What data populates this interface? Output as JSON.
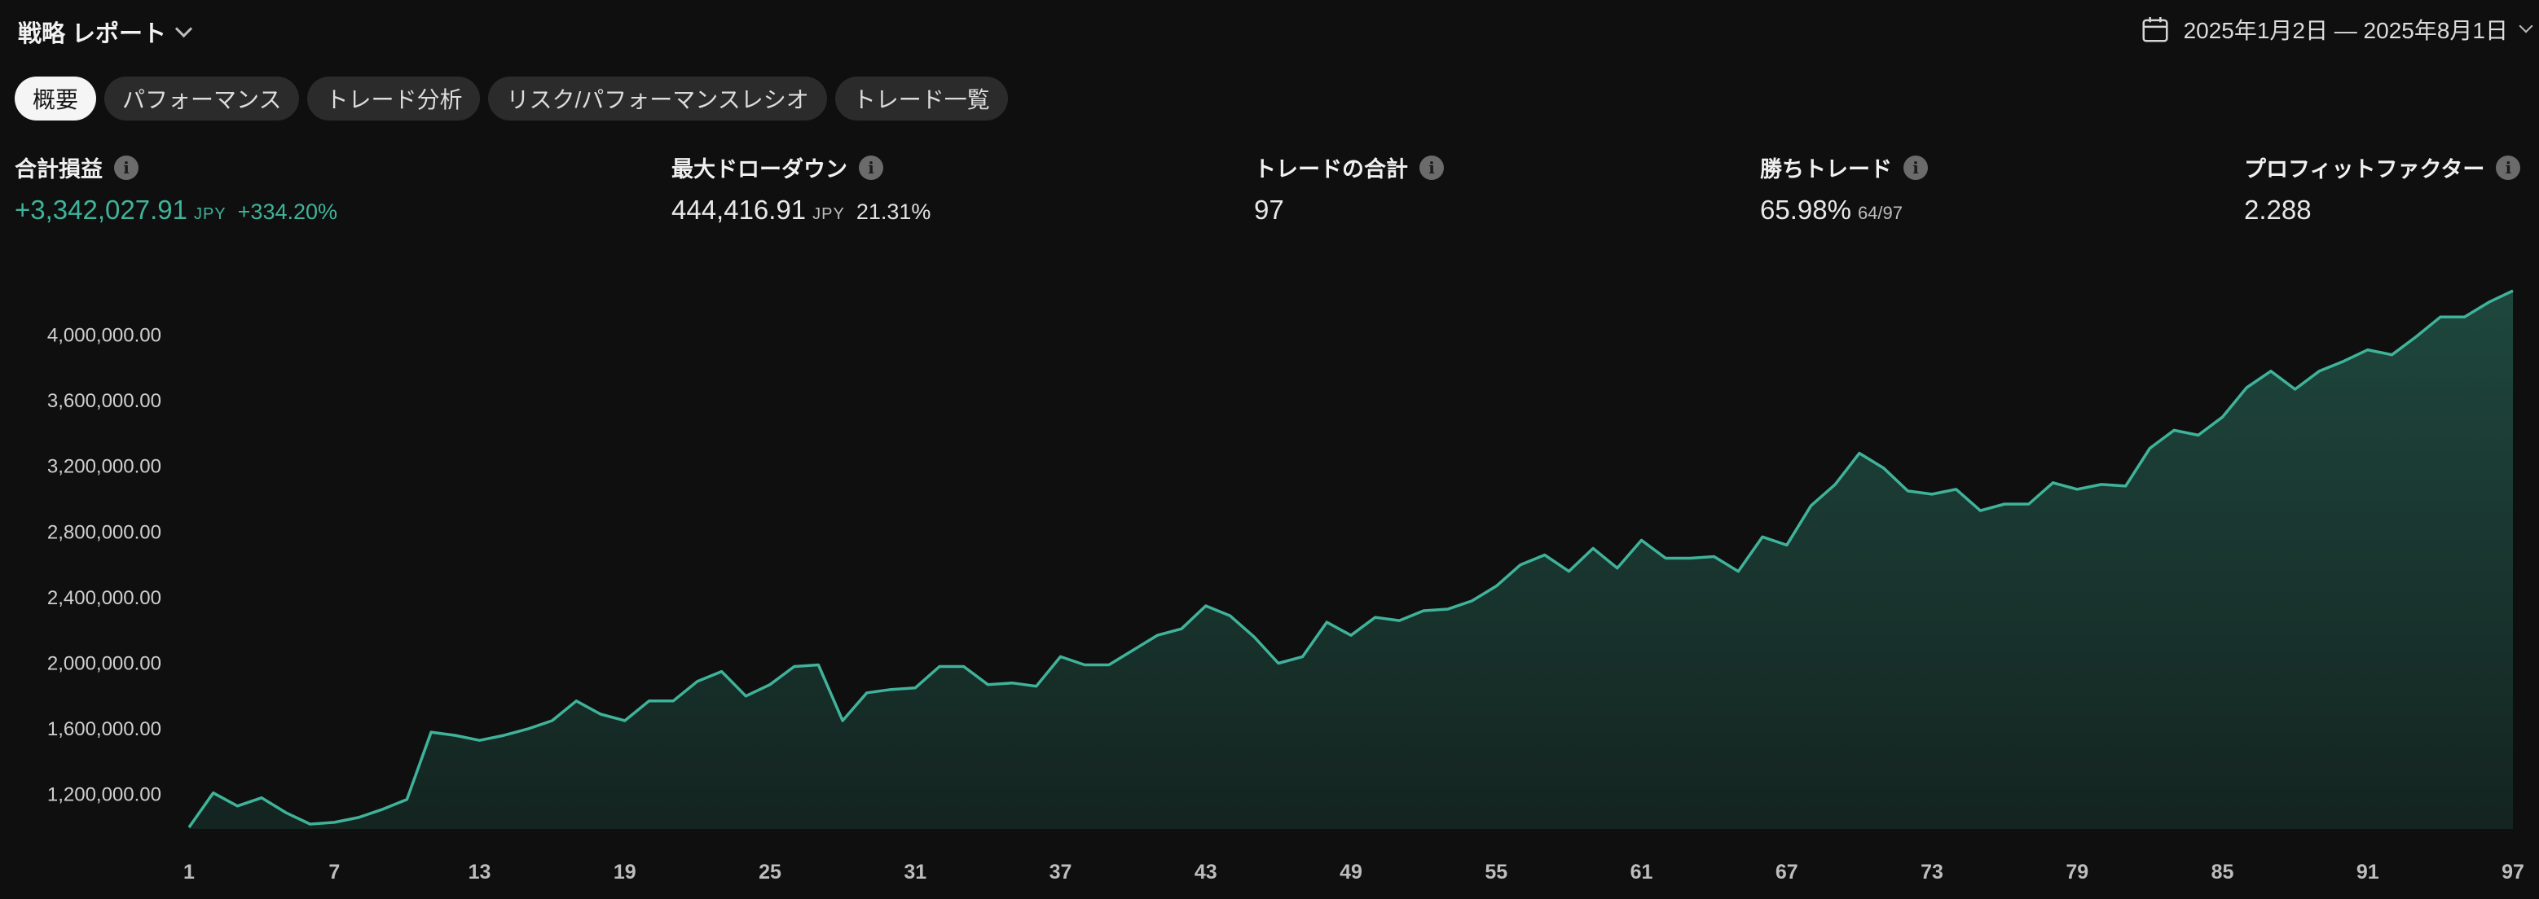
{
  "header": {
    "strategy_title": "戦略 レポート",
    "date_range": "2025年1月2日 — 2025年8月1日"
  },
  "tabs": [
    {
      "label": "概要",
      "active": true
    },
    {
      "label": "パフォーマンス",
      "active": false
    },
    {
      "label": "トレード分析",
      "active": false
    },
    {
      "label": "リスク/パフォーマンスレシオ",
      "active": false
    },
    {
      "label": "トレード一覧",
      "active": false
    }
  ],
  "metrics": {
    "net_profit": {
      "label": "合計損益",
      "value": "+3,342,027.91",
      "unit": "JPY",
      "percent": "+334.20%"
    },
    "max_drawdown": {
      "label": "最大ドローダウン",
      "value": "444,416.91",
      "unit": "JPY",
      "percent": "21.31%"
    },
    "total_trades": {
      "label": "トレードの合計",
      "value": "97"
    },
    "win_trades": {
      "label": "勝ちトレード",
      "value": "65.98%",
      "sub": "64/97"
    },
    "profit_factor": {
      "label": "プロフィットファクター",
      "value": "2.288"
    }
  },
  "colors": {
    "background": "#0f0f0f",
    "accent": "#3fb39a",
    "tab_active_bg": "#f5f5f5",
    "tab_bg": "#2b2b2b"
  },
  "chart_data": {
    "type": "area",
    "title": "",
    "xlabel": "",
    "ylabel": "",
    "xlim": [
      1,
      97
    ],
    "ylim": [
      990000,
      4330000
    ],
    "x_ticks": [
      1,
      7,
      13,
      19,
      25,
      31,
      37,
      43,
      49,
      55,
      61,
      67,
      73,
      79,
      85,
      91,
      97
    ],
    "y_ticks": [
      {
        "value": 1200000,
        "label": "1,200,000.00"
      },
      {
        "value": 1600000,
        "label": "1,600,000.00"
      },
      {
        "value": 2000000,
        "label": "2,000,000.00"
      },
      {
        "value": 2400000,
        "label": "2,400,000.00"
      },
      {
        "value": 2800000,
        "label": "2,800,000.00"
      },
      {
        "value": 3200000,
        "label": "3,200,000.00"
      },
      {
        "value": 3600000,
        "label": "3,600,000.00"
      },
      {
        "value": 4000000,
        "label": "4,000,000.00"
      }
    ],
    "grid": false,
    "series": [
      {
        "values": [
          1000000,
          1210000,
          1130000,
          1180000,
          1090000,
          1020000,
          1030000,
          1060000,
          1110000,
          1170000,
          1580000,
          1560000,
          1530000,
          1560000,
          1600000,
          1650000,
          1770000,
          1690000,
          1650000,
          1770000,
          1770000,
          1890000,
          1950000,
          1800000,
          1870000,
          1980000,
          1990000,
          1650000,
          1820000,
          1840000,
          1850000,
          1980000,
          1980000,
          1870000,
          1880000,
          1860000,
          2040000,
          1990000,
          1990000,
          2080000,
          2170000,
          2210000,
          2350000,
          2290000,
          2160000,
          2000000,
          2040000,
          2250000,
          2170000,
          2280000,
          2260000,
          2320000,
          2330000,
          2380000,
          2470000,
          2600000,
          2660000,
          2560000,
          2700000,
          2580000,
          2750000,
          2640000,
          2640000,
          2650000,
          2560000,
          2770000,
          2720000,
          2960000,
          3090000,
          3280000,
          3190000,
          3050000,
          3030000,
          3060000,
          2930000,
          2970000,
          2970000,
          3100000,
          3060000,
          3090000,
          3080000,
          3310000,
          3420000,
          3390000,
          3500000,
          3680000,
          3780000,
          3670000,
          3780000,
          3840000,
          3910000,
          3880000,
          3990000,
          4110000,
          4110000,
          4200000,
          4270000
        ]
      }
    ]
  }
}
